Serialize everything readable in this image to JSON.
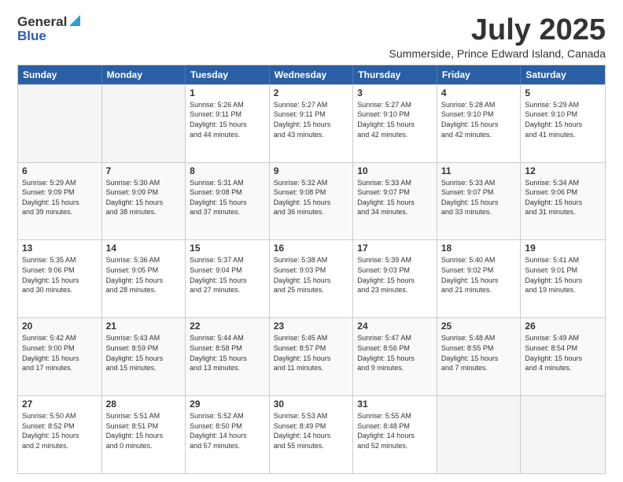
{
  "header": {
    "logo_general": "General",
    "logo_blue": "Blue",
    "month_title": "July 2025",
    "subtitle": "Summerside, Prince Edward Island, Canada"
  },
  "weekdays": [
    "Sunday",
    "Monday",
    "Tuesday",
    "Wednesday",
    "Thursday",
    "Friday",
    "Saturday"
  ],
  "rows": [
    [
      {
        "day": "",
        "detail": ""
      },
      {
        "day": "",
        "detail": ""
      },
      {
        "day": "1",
        "detail": "Sunrise: 5:26 AM\nSunset: 9:11 PM\nDaylight: 15 hours\nand 44 minutes."
      },
      {
        "day": "2",
        "detail": "Sunrise: 5:27 AM\nSunset: 9:11 PM\nDaylight: 15 hours\nand 43 minutes."
      },
      {
        "day": "3",
        "detail": "Sunrise: 5:27 AM\nSunset: 9:10 PM\nDaylight: 15 hours\nand 42 minutes."
      },
      {
        "day": "4",
        "detail": "Sunrise: 5:28 AM\nSunset: 9:10 PM\nDaylight: 15 hours\nand 42 minutes."
      },
      {
        "day": "5",
        "detail": "Sunrise: 5:29 AM\nSunset: 9:10 PM\nDaylight: 15 hours\nand 41 minutes."
      }
    ],
    [
      {
        "day": "6",
        "detail": "Sunrise: 5:29 AM\nSunset: 9:09 PM\nDaylight: 15 hours\nand 39 minutes."
      },
      {
        "day": "7",
        "detail": "Sunrise: 5:30 AM\nSunset: 9:09 PM\nDaylight: 15 hours\nand 38 minutes."
      },
      {
        "day": "8",
        "detail": "Sunrise: 5:31 AM\nSunset: 9:08 PM\nDaylight: 15 hours\nand 37 minutes."
      },
      {
        "day": "9",
        "detail": "Sunrise: 5:32 AM\nSunset: 9:08 PM\nDaylight: 15 hours\nand 36 minutes."
      },
      {
        "day": "10",
        "detail": "Sunrise: 5:33 AM\nSunset: 9:07 PM\nDaylight: 15 hours\nand 34 minutes."
      },
      {
        "day": "11",
        "detail": "Sunrise: 5:33 AM\nSunset: 9:07 PM\nDaylight: 15 hours\nand 33 minutes."
      },
      {
        "day": "12",
        "detail": "Sunrise: 5:34 AM\nSunset: 9:06 PM\nDaylight: 15 hours\nand 31 minutes."
      }
    ],
    [
      {
        "day": "13",
        "detail": "Sunrise: 5:35 AM\nSunset: 9:06 PM\nDaylight: 15 hours\nand 30 minutes."
      },
      {
        "day": "14",
        "detail": "Sunrise: 5:36 AM\nSunset: 9:05 PM\nDaylight: 15 hours\nand 28 minutes."
      },
      {
        "day": "15",
        "detail": "Sunrise: 5:37 AM\nSunset: 9:04 PM\nDaylight: 15 hours\nand 27 minutes."
      },
      {
        "day": "16",
        "detail": "Sunrise: 5:38 AM\nSunset: 9:03 PM\nDaylight: 15 hours\nand 25 minutes."
      },
      {
        "day": "17",
        "detail": "Sunrise: 5:39 AM\nSunset: 9:03 PM\nDaylight: 15 hours\nand 23 minutes."
      },
      {
        "day": "18",
        "detail": "Sunrise: 5:40 AM\nSunset: 9:02 PM\nDaylight: 15 hours\nand 21 minutes."
      },
      {
        "day": "19",
        "detail": "Sunrise: 5:41 AM\nSunset: 9:01 PM\nDaylight: 15 hours\nand 19 minutes."
      }
    ],
    [
      {
        "day": "20",
        "detail": "Sunrise: 5:42 AM\nSunset: 9:00 PM\nDaylight: 15 hours\nand 17 minutes."
      },
      {
        "day": "21",
        "detail": "Sunrise: 5:43 AM\nSunset: 8:59 PM\nDaylight: 15 hours\nand 15 minutes."
      },
      {
        "day": "22",
        "detail": "Sunrise: 5:44 AM\nSunset: 8:58 PM\nDaylight: 15 hours\nand 13 minutes."
      },
      {
        "day": "23",
        "detail": "Sunrise: 5:45 AM\nSunset: 8:57 PM\nDaylight: 15 hours\nand 11 minutes."
      },
      {
        "day": "24",
        "detail": "Sunrise: 5:47 AM\nSunset: 8:56 PM\nDaylight: 15 hours\nand 9 minutes."
      },
      {
        "day": "25",
        "detail": "Sunrise: 5:48 AM\nSunset: 8:55 PM\nDaylight: 15 hours\nand 7 minutes."
      },
      {
        "day": "26",
        "detail": "Sunrise: 5:49 AM\nSunset: 8:54 PM\nDaylight: 15 hours\nand 4 minutes."
      }
    ],
    [
      {
        "day": "27",
        "detail": "Sunrise: 5:50 AM\nSunset: 8:52 PM\nDaylight: 15 hours\nand 2 minutes."
      },
      {
        "day": "28",
        "detail": "Sunrise: 5:51 AM\nSunset: 8:51 PM\nDaylight: 15 hours\nand 0 minutes."
      },
      {
        "day": "29",
        "detail": "Sunrise: 5:52 AM\nSunset: 8:50 PM\nDaylight: 14 hours\nand 57 minutes."
      },
      {
        "day": "30",
        "detail": "Sunrise: 5:53 AM\nSunset: 8:49 PM\nDaylight: 14 hours\nand 55 minutes."
      },
      {
        "day": "31",
        "detail": "Sunrise: 5:55 AM\nSunset: 8:48 PM\nDaylight: 14 hours\nand 52 minutes."
      },
      {
        "day": "",
        "detail": ""
      },
      {
        "day": "",
        "detail": ""
      }
    ]
  ]
}
